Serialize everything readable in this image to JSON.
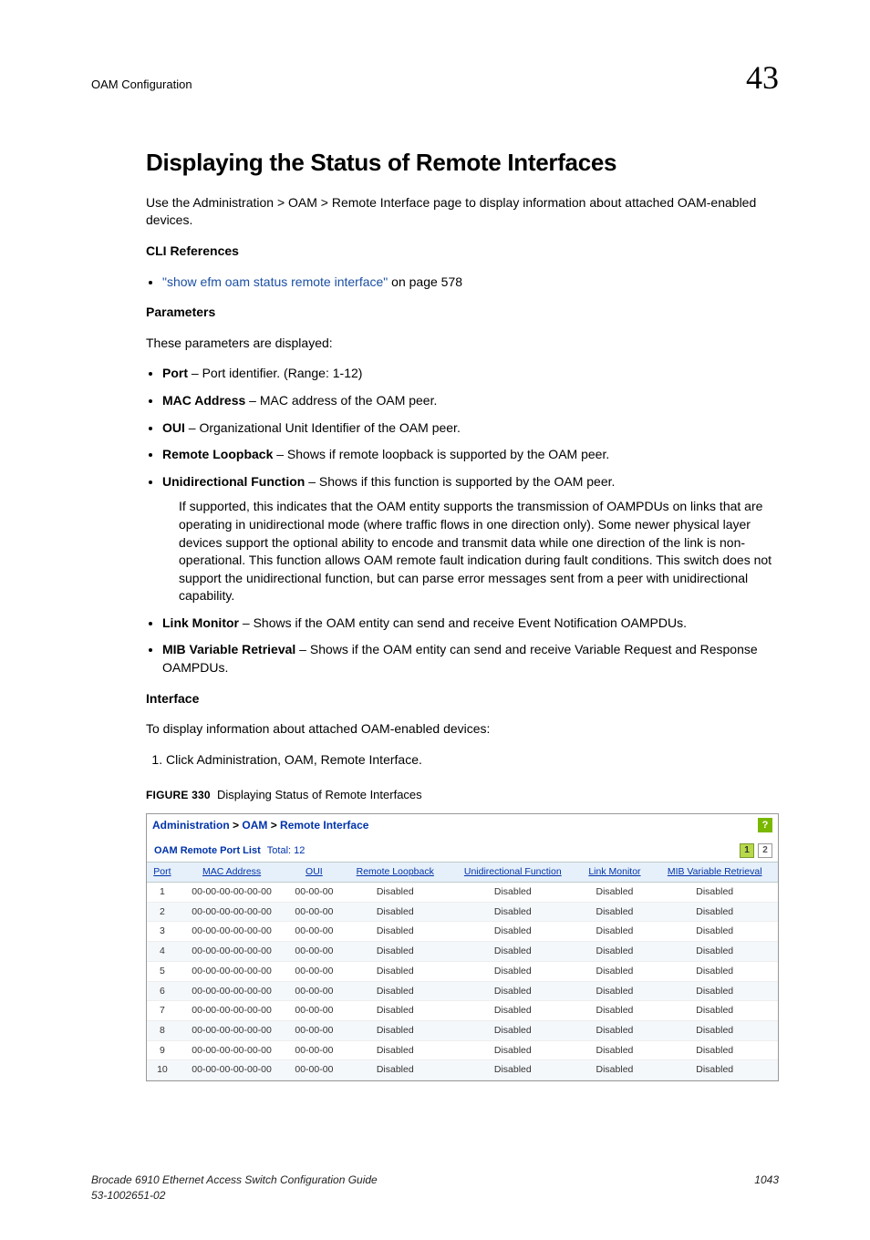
{
  "header": {
    "docsection": "OAM Configuration",
    "chapter": "43"
  },
  "title": "Displaying the Status of Remote Interfaces",
  "intro": "Use the Administration > OAM > Remote Interface page to display information about attached OAM-enabled devices.",
  "cli_heading": "CLI References",
  "cli_link_quote": "\"show efm oam status remote interface\"",
  "cli_link_suffix": " on page 578",
  "params_heading": "Parameters",
  "params_intro": "These parameters are displayed:",
  "params": [
    {
      "name": "Port",
      "desc": " – Port identifier. (Range: 1-12)"
    },
    {
      "name": "MAC Address",
      "desc": " – MAC address of the OAM peer."
    },
    {
      "name": "OUI",
      "desc": " – Organizational Unit Identifier of the OAM peer."
    },
    {
      "name": "Remote Loopback",
      "desc": " – Shows if remote loopback is supported by the OAM peer."
    },
    {
      "name": "Unidirectional Function",
      "desc": " – Shows if this function is supported by the OAM peer."
    },
    {
      "name": "Link Monitor",
      "desc": " – Shows if the OAM entity can send and receive Event Notification OAMPDUs."
    },
    {
      "name": "MIB Variable Retrieval",
      "desc": " – Shows if the OAM entity can send and receive Variable Request and Response OAMPDUs."
    }
  ],
  "unidir_explain": "If supported, this indicates that the OAM entity supports the transmission of OAMPDUs on links that are operating in unidirectional mode (where traffic flows in one direction only). Some newer physical layer devices support the optional ability to encode and transmit data while one direction of the link is non-operational. This function allows OAM remote fault indication during fault conditions. This switch does not support the unidirectional function, but can parse error messages sent from a peer with unidirectional capability.",
  "iface_heading": "Interface",
  "iface_intro": "To display information about attached OAM-enabled devices:",
  "iface_step": "Click Administration, OAM, Remote Interface.",
  "figure": {
    "label": "FIGURE 330",
    "caption": "Displaying Status of Remote Interfaces"
  },
  "screenshot": {
    "breadcrumb": [
      "Administration",
      "OAM",
      "Remote Interface"
    ],
    "help": "?",
    "list_title": "OAM Remote Port List",
    "total_label": "Total:",
    "total_value": "12",
    "pages": [
      "1",
      "2"
    ],
    "headers": [
      "Port",
      "MAC Address",
      "OUI",
      "Remote Loopback",
      "Unidirectional Function",
      "Link Monitor",
      "MIB Variable Retrieval"
    ],
    "rows": [
      [
        "1",
        "00-00-00-00-00-00",
        "00-00-00",
        "Disabled",
        "Disabled",
        "Disabled",
        "Disabled"
      ],
      [
        "2",
        "00-00-00-00-00-00",
        "00-00-00",
        "Disabled",
        "Disabled",
        "Disabled",
        "Disabled"
      ],
      [
        "3",
        "00-00-00-00-00-00",
        "00-00-00",
        "Disabled",
        "Disabled",
        "Disabled",
        "Disabled"
      ],
      [
        "4",
        "00-00-00-00-00-00",
        "00-00-00",
        "Disabled",
        "Disabled",
        "Disabled",
        "Disabled"
      ],
      [
        "5",
        "00-00-00-00-00-00",
        "00-00-00",
        "Disabled",
        "Disabled",
        "Disabled",
        "Disabled"
      ],
      [
        "6",
        "00-00-00-00-00-00",
        "00-00-00",
        "Disabled",
        "Disabled",
        "Disabled",
        "Disabled"
      ],
      [
        "7",
        "00-00-00-00-00-00",
        "00-00-00",
        "Disabled",
        "Disabled",
        "Disabled",
        "Disabled"
      ],
      [
        "8",
        "00-00-00-00-00-00",
        "00-00-00",
        "Disabled",
        "Disabled",
        "Disabled",
        "Disabled"
      ],
      [
        "9",
        "00-00-00-00-00-00",
        "00-00-00",
        "Disabled",
        "Disabled",
        "Disabled",
        "Disabled"
      ],
      [
        "10",
        "00-00-00-00-00-00",
        "00-00-00",
        "Disabled",
        "Disabled",
        "Disabled",
        "Disabled"
      ]
    ]
  },
  "footer": {
    "left1": "Brocade 6910 Ethernet Access Switch Configuration Guide",
    "left2": "53-1002651-02",
    "page": "1043"
  }
}
